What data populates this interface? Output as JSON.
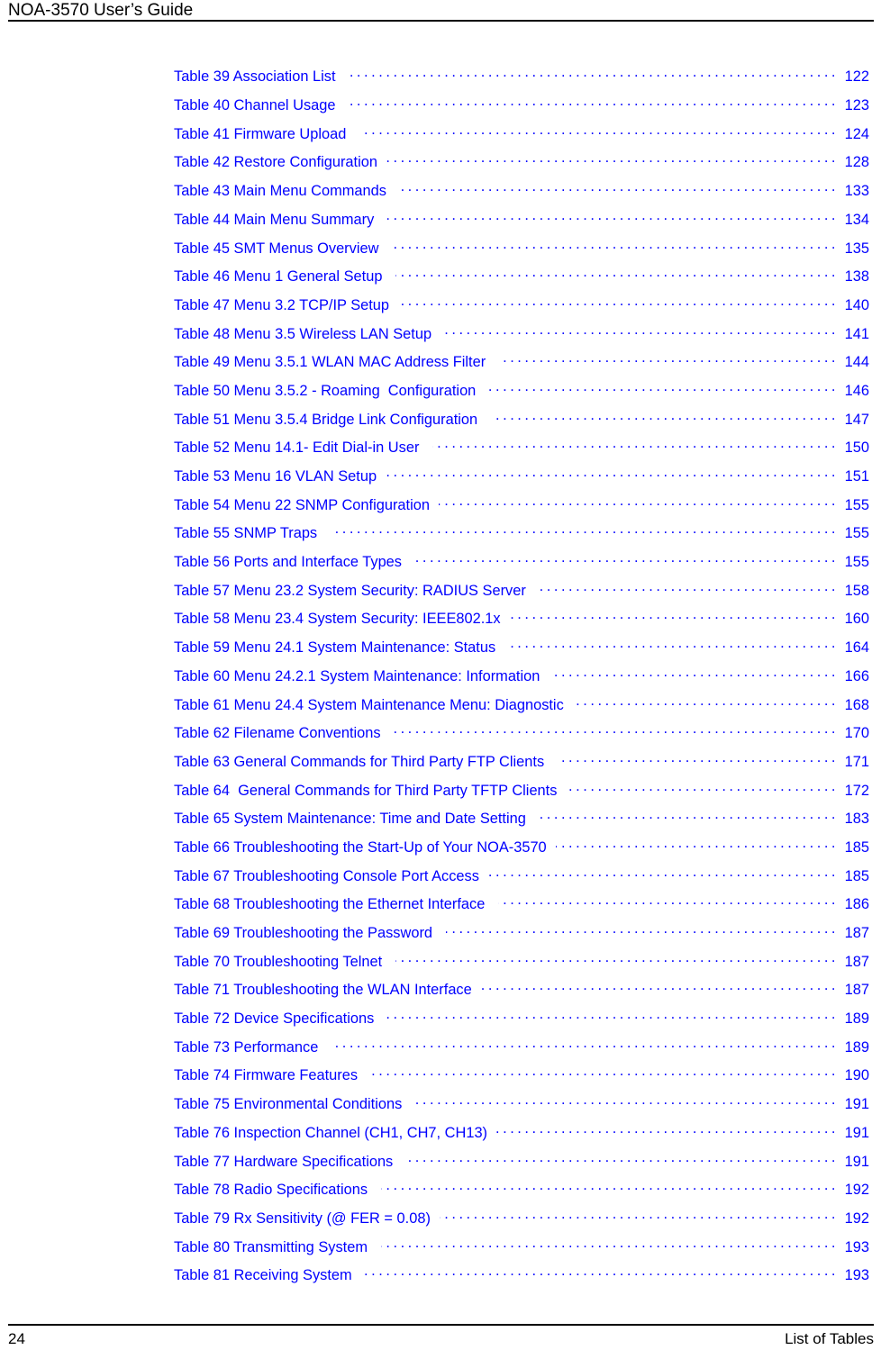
{
  "header": {
    "title": "NOA-3570 User’s Guide"
  },
  "footer": {
    "page_number": "24",
    "section": "List of Tables"
  },
  "colors": {
    "entry_text": "#0000FF",
    "header_text": "#000000",
    "rule": "#000000",
    "background": "#FFFFFF"
  },
  "toc": {
    "entries": [
      {
        "title": "Table 39 Association List",
        "page": "122"
      },
      {
        "title": "Table 40 Channel Usage",
        "page": "123"
      },
      {
        "title": "Table 41 Firmware Upload ",
        "page": "124"
      },
      {
        "title": "Table 42 Restore Configuration",
        "page": "128"
      },
      {
        "title": "Table 43 Main Menu Commands ",
        "page": "133"
      },
      {
        "title": "Table 44 Main Menu Summary ",
        "page": "134"
      },
      {
        "title": "Table 45 SMT Menus Overview ",
        "page": "135"
      },
      {
        "title": "Table 46 Menu 1 General Setup ",
        "page": "138"
      },
      {
        "title": "Table 47 Menu 3.2 TCP/IP Setup",
        "page": "140"
      },
      {
        "title": "Table 48 Menu 3.5 Wireless LAN Setup ",
        "page": "141"
      },
      {
        "title": "Table 49 Menu 3.5.1 WLAN MAC Address Filter ",
        "page": "144"
      },
      {
        "title": "Table 50 Menu 3.5.2 - Roaming  Configuration",
        "page": "146"
      },
      {
        "title": "Table 51 Menu 3.5.4 Bridge Link Configuration ",
        "page": "147"
      },
      {
        "title": "Table 52 Menu 14.1- Edit Dial-in User ",
        "page": "150"
      },
      {
        "title": "Table 53 Menu 16 VLAN Setup",
        "page": "151"
      },
      {
        "title": "Table 54 Menu 22 SNMP Configuration",
        "page": "155"
      },
      {
        "title": "Table 55 SNMP Traps ",
        "page": "155"
      },
      {
        "title": "Table 56 Ports and Interface Types",
        "page": "155"
      },
      {
        "title": "Table 57 Menu 23.2 System Security: RADIUS Server ",
        "page": "158"
      },
      {
        "title": "Table 58 Menu 23.4 System Security: IEEE802.1x",
        "page": "160"
      },
      {
        "title": "Table 59 Menu 24.1 System Maintenance: Status ",
        "page": "164"
      },
      {
        "title": "Table 60 Menu 24.2.1 System Maintenance: Information ",
        "page": "166"
      },
      {
        "title": "Table 61 Menu 24.4 System Maintenance Menu: Diagnostic ",
        "page": "168"
      },
      {
        "title": "Table 62 Filename Conventions",
        "page": "170"
      },
      {
        "title": "Table 63 General Commands for Third Party FTP Clients ",
        "page": "171"
      },
      {
        "title": "Table 64  General Commands for Third Party TFTP Clients",
        "page": "172"
      },
      {
        "title": "Table 65 System Maintenance: Time and Date Setting ",
        "page": "183"
      },
      {
        "title": "Table 66 Troubleshooting the Start-Up of Your NOA-3570",
        "page": "185"
      },
      {
        "title": "Table 67 Troubleshooting Console Port Access",
        "page": "185"
      },
      {
        "title": "Table 68 Troubleshooting the Ethernet Interface ",
        "page": "186"
      },
      {
        "title": "Table 69 Troubleshooting the Password ",
        "page": "187"
      },
      {
        "title": "Table 70 Troubleshooting Telnet ",
        "page": "187"
      },
      {
        "title": "Table 71 Troubleshooting the WLAN Interface",
        "page": "187"
      },
      {
        "title": "Table 72 Device Specifications",
        "page": "189"
      },
      {
        "title": "Table 73 Performance ",
        "page": "189"
      },
      {
        "title": "Table 74 Firmware Features ",
        "page": "190"
      },
      {
        "title": "Table 75 Environmental Conditions",
        "page": "191"
      },
      {
        "title": "Table 76 Inspection Channel (CH1, CH7, CH13)",
        "page": "191"
      },
      {
        "title": "Table 77 Hardware Specifications ",
        "page": "191"
      },
      {
        "title": "Table 78 Radio Specifications ",
        "page": "192"
      },
      {
        "title": "Table 79 Rx Sensitivity (@ FER = 0.08)",
        "page": "192"
      },
      {
        "title": "Table 80 Transmitting System ",
        "page": "193"
      },
      {
        "title": "Table 81 Receiving System",
        "page": "193"
      }
    ]
  }
}
